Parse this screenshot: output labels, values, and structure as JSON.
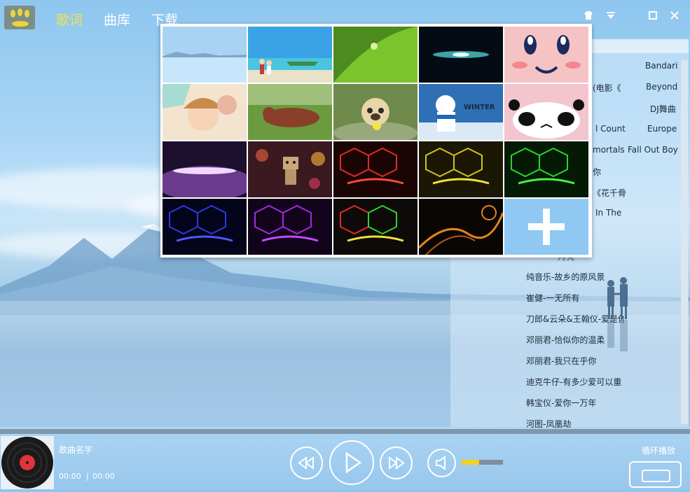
{
  "header": {
    "tabs": [
      {
        "label": "歌词",
        "active": true
      },
      {
        "label": "曲库",
        "active": false
      },
      {
        "label": "下载",
        "active": false
      }
    ],
    "window_controls": [
      "skin-icon",
      "menu-icon",
      "maximize-icon",
      "close-icon"
    ]
  },
  "playlist": {
    "left_items": [
      "纯音乐-故乡的原风景",
      "崔健-一无所有",
      "刀郎&云朵&王翰仪-爱是你",
      "邓丽君-恰似你的温柔",
      "邓丽君-我只在乎你",
      "迪克牛仔-有多少爱可以重",
      "韩宝仪-爱你一万年",
      "河图-凤凰劫"
    ],
    "right_items": [
      "Bandari",
      "Beyond",
      "DJ舞曲",
      "Europe",
      "Fall Out Boy"
    ],
    "peek_items": [
      "(电影《",
      "l Count",
      "mortals",
      "你",
      "《花千骨",
      "In The",
      "-月亮"
    ]
  },
  "skin_picker": {
    "tiles": [
      "salt-flat-sky",
      "beach-couple",
      "green-leaf-drop",
      "galaxy",
      "kirby-face",
      "anime-puzzle",
      "teddy-bear-grass",
      "pug-toy",
      "winter-snowman",
      "panda-smile",
      "purple-glow",
      "danbo-bokeh",
      "red-hex-neon",
      "yellow-hex-neon",
      "green-hex-neon",
      "blue-hex-neon",
      "purple-hex-neon",
      "rainbow-hex-neon",
      "orange-swirl",
      "add-skin"
    ],
    "add_label": "+"
  },
  "player": {
    "song_name": "歌曲名字",
    "current_time": "00:00",
    "separator": "|",
    "total_time": "00:00",
    "play_mode": "循环播放",
    "progress": 0.0,
    "volume": 0.42
  },
  "colors": {
    "accent_active_tab": "#f6e14b",
    "volume_fill": "#f2d21c"
  }
}
